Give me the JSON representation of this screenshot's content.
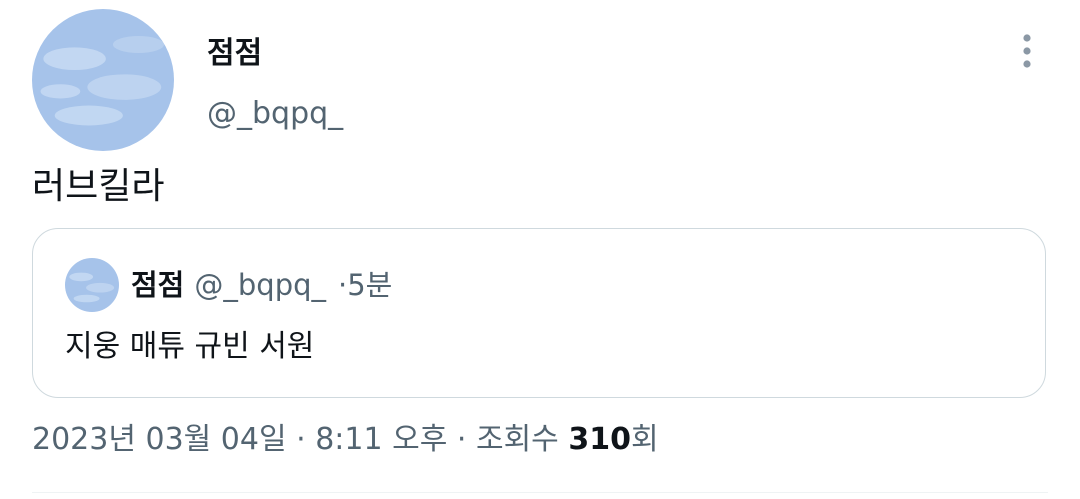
{
  "tweet": {
    "author": {
      "display_name": "점점",
      "handle": "@_bqpq_",
      "avatar_icon": "sky-clouds-avatar"
    },
    "more_icon": "more-vertical-icon",
    "text": "러브킬라",
    "quoted": {
      "display_name": "점점",
      "handle": "@_bqpq_",
      "separator": "·",
      "time": "5분",
      "text": "지웅 매튜 규빈 서원"
    },
    "meta": {
      "date": "2023년 03월 04일",
      "sep1": "·",
      "time": "8:11 오후",
      "sep2": "·",
      "views_label": "조회수",
      "views_count": "310",
      "views_unit": "회"
    }
  },
  "colors": {
    "text_primary": "#0f1419",
    "text_secondary": "#536471",
    "border": "#cfd9de",
    "avatar_sky": "#a9c6ec"
  }
}
